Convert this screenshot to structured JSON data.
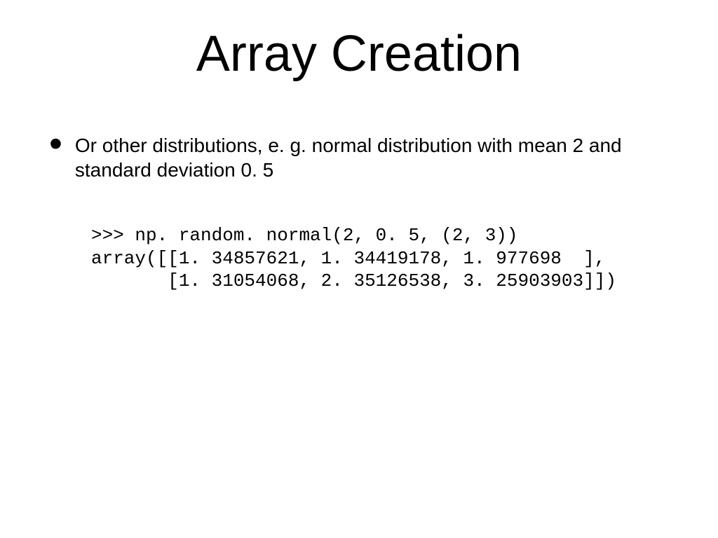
{
  "title": "Array Creation",
  "bullet": "Or other distributions, e. g. normal distribution with mean 2 and standard deviation 0. 5",
  "code": {
    "line1": ">>> np. random. normal(2, 0. 5, (2, 3))",
    "line2": "array([[1. 34857621, 1. 34419178, 1. 977698  ],",
    "line3": "       [1. 31054068, 2. 35126538, 3. 25903903]])"
  }
}
